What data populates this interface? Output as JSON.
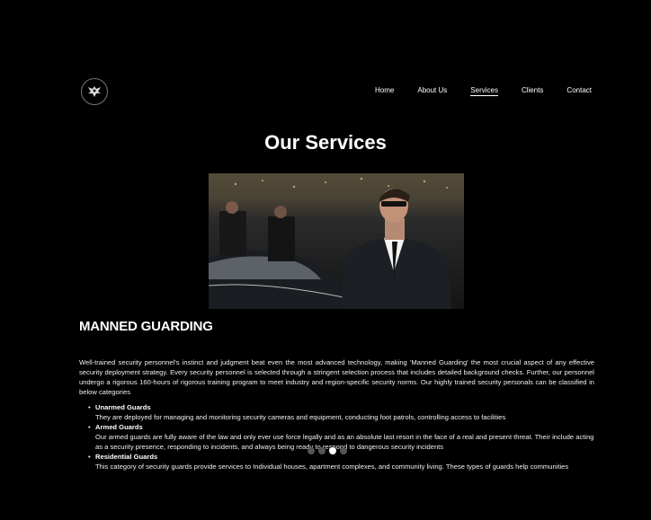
{
  "header": {
    "logo_icon": "eagle-emblem-icon",
    "nav": [
      {
        "label": "Home",
        "active": false
      },
      {
        "label": "About Us",
        "active": false
      },
      {
        "label": "Services",
        "active": true
      },
      {
        "label": "Clients",
        "active": false
      },
      {
        "label": "Contact",
        "active": false
      }
    ]
  },
  "main": {
    "title": "Our Services",
    "hero_image": "security-guards-photo",
    "section_title": "MANNED GUARDING",
    "intro": "Well-trained security personnel's instinct and judgment beat even the most advanced technology, making 'Manned Guarding' the most crucial aspect of any effective security deployment strategy. Every security personnel is selected through a stringent selection process that includes detailed background checks. Further, our personnel undergo a rigorous 160-hours of rigorous training program to meet industry and region-specific security norms. Our highly trained security personals can be classified in below categories",
    "services": [
      {
        "name": "Unarmed Guards",
        "desc": "They are deployed for managing and monitoring security cameras and equipment, conducting foot patrols, controlling access to facilities"
      },
      {
        "name": "Armed Guards",
        "desc": "Our armed guards are fully aware of the law and only ever use force legally and as an absolute last resort in the face of a real and present threat. Their include acting as a security presence, responding to incidents, and always being ready to respond to dangerous security incidents"
      },
      {
        "name": "Residential Guards",
        "desc": "This category of security guards provide services to Individual houses, apartment complexes, and community living. These types of guards help communities"
      }
    ],
    "carousel": {
      "count": 4,
      "active_index": 2
    }
  }
}
